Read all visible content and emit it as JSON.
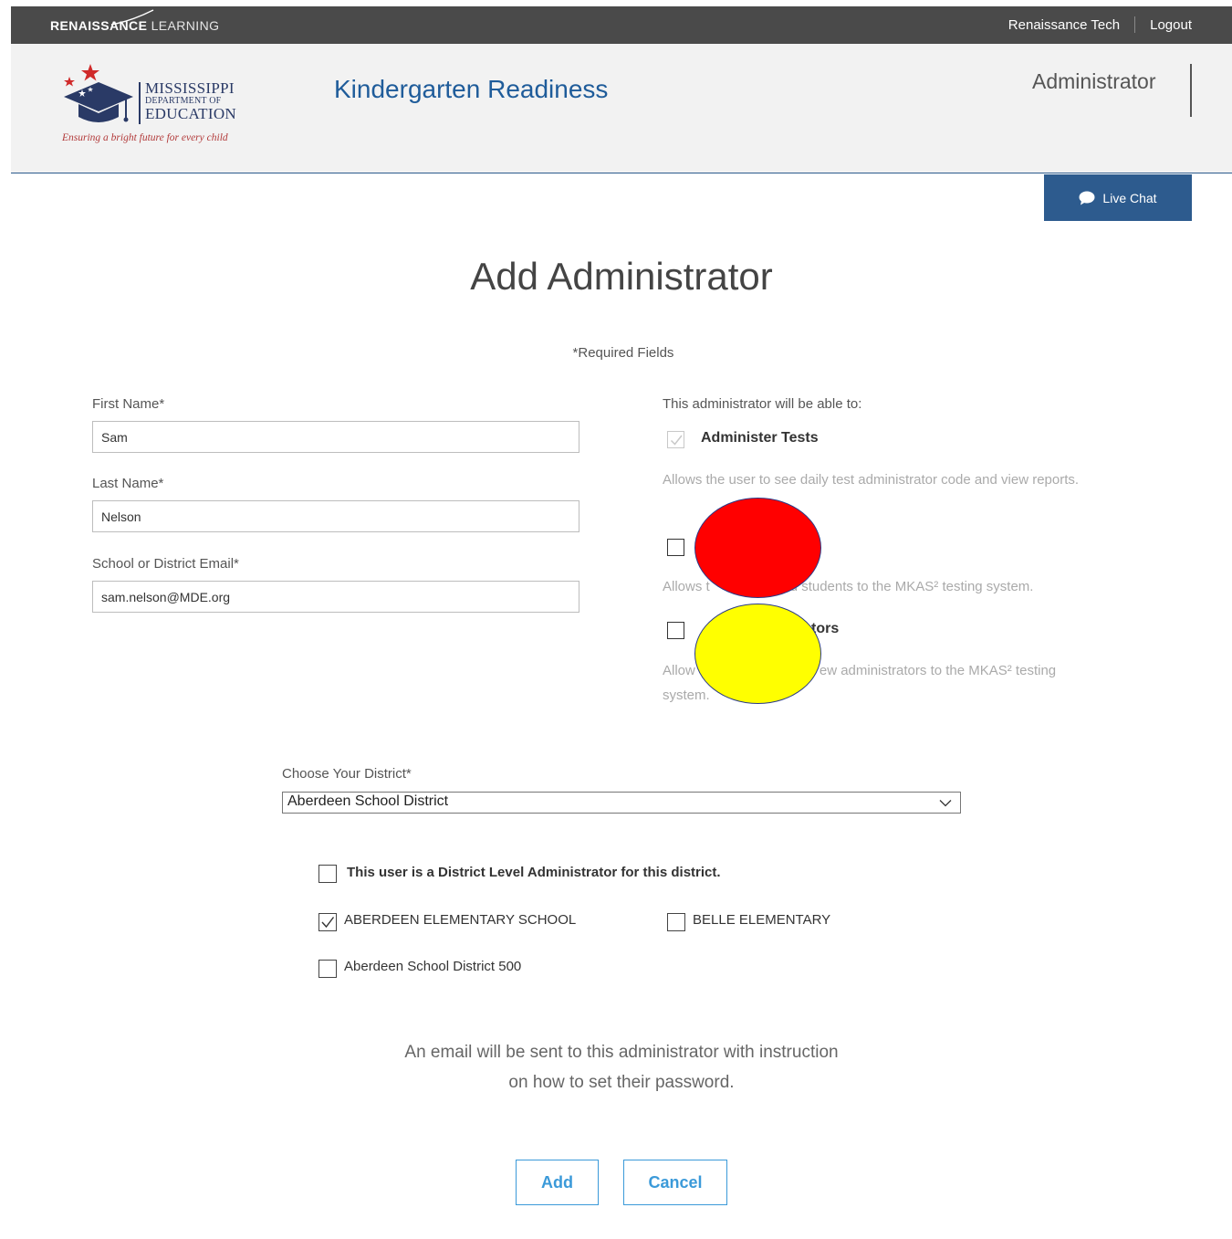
{
  "topbar": {
    "brand_bold": "RENAISSANCE",
    "brand_light": "LEARNING",
    "user_link": "Renaissance Tech",
    "logout_link": "Logout"
  },
  "header": {
    "logo_line1": "MISSISSIPPI",
    "logo_line2": "DEPARTMENT OF",
    "logo_line3": "EDUCATION",
    "logo_tagline": "Ensuring a bright future for every child",
    "app_title": "Kindergarten Readiness",
    "role": "Administrator"
  },
  "live_chat": {
    "label": "Live Chat",
    "icon": "chat-bubble-icon"
  },
  "page_title": "Add Administrator",
  "required_note": "*Required Fields",
  "form": {
    "first_name": {
      "label": "First Name*",
      "value": "Sam"
    },
    "last_name": {
      "label": "Last Name*",
      "value": "Nelson"
    },
    "email": {
      "label": "School or District Email*",
      "value": "sam.nelson@MDE.org"
    }
  },
  "permissions": {
    "intro": "This administrator will be able to:",
    "items": [
      {
        "label": "Administer Tests",
        "description": "Allows the user to see daily test administrator code and view reports.",
        "checked": true,
        "disabled": true
      },
      {
        "label": "",
        "description_prefix": "Allows t",
        "description_suffix": "d students to the MKAS² testing system.",
        "checked": false
      },
      {
        "label_suffix": "tors",
        "description_prefix": "Allow",
        "description_suffix": "ew administrators to the MKAS² testing",
        "description_line2": "system.",
        "checked": false
      }
    ]
  },
  "redactions": {
    "colors": [
      "#ff0000",
      "#ffff00"
    ]
  },
  "district": {
    "label": "Choose Your District*",
    "selected": "Aberdeen School District",
    "district_admin_label": "This user is a District Level Administrator for this district.",
    "schools": [
      {
        "name": "ABERDEEN ELEMENTARY SCHOOL",
        "checked": true
      },
      {
        "name": "BELLE ELEMENTARY",
        "checked": false
      },
      {
        "name": "Aberdeen School District 500",
        "checked": false
      }
    ]
  },
  "email_note": {
    "line1": "An email will be sent to this administrator with instruction",
    "line2": "on how to set their password."
  },
  "buttons": {
    "add": "Add",
    "cancel": "Cancel"
  },
  "colors": {
    "accent": "#3b9ad9",
    "brand_blue": "#1f5c9a",
    "chat_bg": "#2d5b8e",
    "topbar_bg": "#4a4a4a"
  }
}
